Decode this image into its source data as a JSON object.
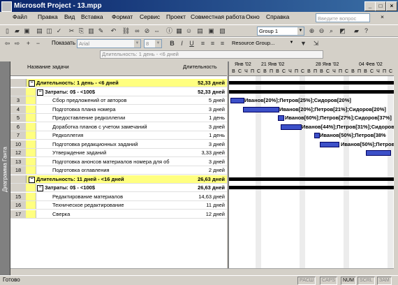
{
  "window": {
    "title": "Microsoft Project - 13.mpp"
  },
  "menu": [
    "Файл",
    "Правка",
    "Вид",
    "Вставка",
    "Формат",
    "Сервис",
    "Проект",
    "Совместная работа",
    "Окно",
    "Справка"
  ],
  "ask_placeholder": "Введите вопрос",
  "toolbar1": {
    "group_select": "Group 1"
  },
  "toolbar2": {
    "show_label": "Показать",
    "font": "Arial",
    "font_size": "8",
    "resource_group": "Resource Group..."
  },
  "entry_bar": {
    "value": "Длительность: 1 день - <6 дней"
  },
  "view_bar_label": "Диаграмма Ганта",
  "table_headers": {
    "name": "Название задачи",
    "duration": "Длительность"
  },
  "rows": [
    {
      "id": "",
      "name": "Длительность: 1 день - <6 дней",
      "duration": "52,33 дней",
      "type": "group"
    },
    {
      "id": "",
      "name": "Затраты: 0$ - <100$",
      "duration": "52,33 дней",
      "type": "summary"
    },
    {
      "id": "3",
      "name": "Сбор предложений от авторов",
      "duration": "5 дней",
      "type": "task"
    },
    {
      "id": "4",
      "name": "Подготовка плана номера",
      "duration": "3 дней",
      "type": "task"
    },
    {
      "id": "5",
      "name": "Предоставление редколлегии",
      "duration": "1 день",
      "type": "task"
    },
    {
      "id": "6",
      "name": "Доработка планов с учетом замечаний",
      "duration": "3 дней",
      "type": "task"
    },
    {
      "id": "7",
      "name": "Редколлегия",
      "duration": "1 день",
      "type": "task"
    },
    {
      "id": "10",
      "name": "Подготовка редакционных заданий",
      "duration": "3 дней",
      "type": "task"
    },
    {
      "id": "12",
      "name": "Утверждение заданий",
      "duration": "3,33 дней",
      "type": "task"
    },
    {
      "id": "13",
      "name": "Подготовка анонсов материалов номера для об",
      "duration": "3 дней",
      "type": "task"
    },
    {
      "id": "18",
      "name": "Подготовка оглавления",
      "duration": "2 дней",
      "type": "task"
    },
    {
      "id": "",
      "name": "Длительность: 11 дней - <16 дней",
      "duration": "26,63 дней",
      "type": "group"
    },
    {
      "id": "",
      "name": "Затраты: 0$ - <100$",
      "duration": "26,63 дней",
      "type": "summary"
    },
    {
      "id": "15",
      "name": "Редактирование материалов",
      "duration": "14,63 дней",
      "type": "task"
    },
    {
      "id": "16",
      "name": "Техническое редактирование",
      "duration": "11 дней",
      "type": "task"
    },
    {
      "id": "17",
      "name": "Сверка",
      "duration": "12 дней",
      "type": "task"
    }
  ],
  "gantt": {
    "weeks": [
      "Янв '02",
      "21 Янв '02",
      "28 Янв '02",
      "04 Фев '02"
    ],
    "days": [
      "В",
      "С",
      "Ч",
      "П",
      "С",
      "В",
      "П",
      "В",
      "С",
      "Ч",
      "П",
      "С",
      "В",
      "П",
      "В",
      "С",
      "Ч",
      "П",
      "С",
      "В",
      "П",
      "В",
      "С",
      "Ч",
      "П",
      "С"
    ],
    "labels": [
      {
        "row": 2,
        "text": "Иванов[20%];Петров[25%];Сидоров[20%]"
      },
      {
        "row": 3,
        "text": "Иванов[20%];Петров[21%];Сидоров[20%]"
      },
      {
        "row": 4,
        "text": "Иванов[60%];Петров[27%];Сидоров[37%]"
      },
      {
        "row": 5,
        "text": "Иванов[44%];Петров[31%];Сидоров"
      },
      {
        "row": 6,
        "text": "Иванов[50%];Петров[38%"
      },
      {
        "row": 7,
        "text": "Иванов[50%];Петров[3"
      }
    ]
  },
  "status": {
    "ready": "Готово",
    "indicators": [
      "РАСШ",
      "CAPS",
      "NUM",
      "SCRL",
      "ЗАМ"
    ]
  }
}
